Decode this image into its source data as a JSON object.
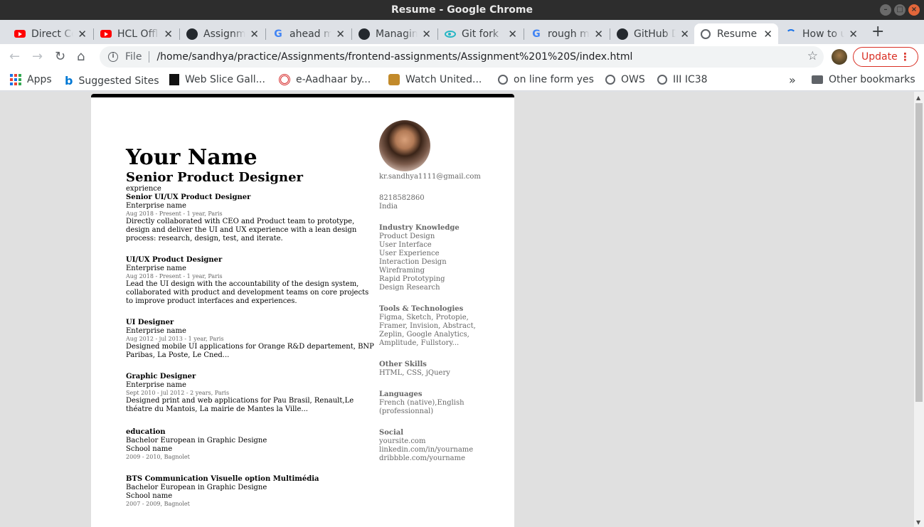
{
  "window": {
    "title": "Resume - Google Chrome"
  },
  "tabs": [
    {
      "label": "Direct Connect",
      "icon": "youtube-icon"
    },
    {
      "label": "HCL Offline",
      "icon": "youtube-icon"
    },
    {
      "label": "Assignments",
      "icon": "github-icon"
    },
    {
      "label": "ahead meaning",
      "icon": "google-icon"
    },
    {
      "label": "Managing",
      "icon": "github-icon"
    },
    {
      "label": "Git fork",
      "icon": "eye-icon"
    },
    {
      "label": "rough meaning",
      "icon": "google-icon"
    },
    {
      "label": "GitHub Desktop",
      "icon": "github-icon"
    },
    {
      "label": "Resume",
      "icon": "globe-icon",
      "active": true
    },
    {
      "label": "How to use",
      "icon": "loading-icon"
    }
  ],
  "toolbar": {
    "omnibox_scheme": "File",
    "url": "/home/sandhya/practice/Assignments/frontend-assignments/Assignment%201%20S/index.html",
    "update_label": "Update"
  },
  "bookmarks": {
    "items": [
      "Apps",
      "Suggested Sites",
      "Web Slice Gall...",
      "e-Aadhaar by...",
      "Watch United...",
      "on line form yes",
      "OWS",
      "III IC38"
    ],
    "other": "Other bookmarks"
  },
  "resume": {
    "name": "Your Name",
    "role": "Senior Product Designer",
    "section_experience": "exprience",
    "jobs": [
      {
        "title": "Senior UI/UX Product Designer",
        "company": "Enterprise name",
        "meta": "Aug 2018 - Present - 1 year, Paris",
        "desc": "Directly collaborated with CEO and Product team to prototype, design and deliver the UI and UX experience with a lean design process: research, design, test, and iterate."
      },
      {
        "title": "UI/UX Product Designer",
        "company": "Enterprise name",
        "meta": "Aug 2018 - Present - 1 year, Paris",
        "desc": "Lead the UI design with the accountability of the design system, collaborated with product and development teams on core projects to improve product interfaces and experiences."
      },
      {
        "title": "UI Designer",
        "company": "Enterprise name",
        "meta": "Aug 2012 - jul 2013 - 1 year, Paris",
        "desc": "Designed mobile UI applications for Orange R&D departement, BNP Paribas, La Poste, Le Cned..."
      },
      {
        "title": "Graphic Designer",
        "company": "Enterprise name",
        "meta": "Sept 2010 - jul 2012 - 2 years, Paris",
        "desc": "Designed print and web applications for Pau Brasil, Renault,Le théatre du Mantois, La mairie de Mantes la Ville..."
      }
    ],
    "education": [
      {
        "title": "education",
        "degree": "Bachelor European in Graphic Designe",
        "school": "School name",
        "meta": "2009 - 2010, Bagnolet"
      },
      {
        "title": "BTS Communication Visuelle option Multimédia",
        "degree": "Bachelor European in Graphic Designe",
        "school": "School name",
        "meta": "2007 - 2009, Bagnolet"
      }
    ],
    "contact": {
      "email": "kr.sandhya1111@gmail.com",
      "phone": "8218582860",
      "country": "India"
    },
    "sidebar": [
      {
        "heading": "Industry Knowledge",
        "items": [
          "Product Design",
          "User Interface",
          "User Experience",
          "Interaction Design",
          "Wireframing",
          "Rapid Prototyping",
          "Design Research"
        ]
      },
      {
        "heading": "Tools & Technologies",
        "items": [
          "Figma, Sketch, Protopie,",
          "Framer, Invision, Abstract,",
          "Zeplin, Google Analytics,",
          "Amplitude, Fullstory..."
        ]
      },
      {
        "heading": "Other Skills",
        "items": [
          "HTML, CSS, jQuery"
        ]
      },
      {
        "heading": "Languages",
        "items": [
          "French (native),English",
          "(professionnal)"
        ]
      },
      {
        "heading": "Social",
        "items": [
          "yoursite.com",
          "linkedin.com/in/yourname",
          "dribbble.com/yourname"
        ]
      }
    ]
  }
}
